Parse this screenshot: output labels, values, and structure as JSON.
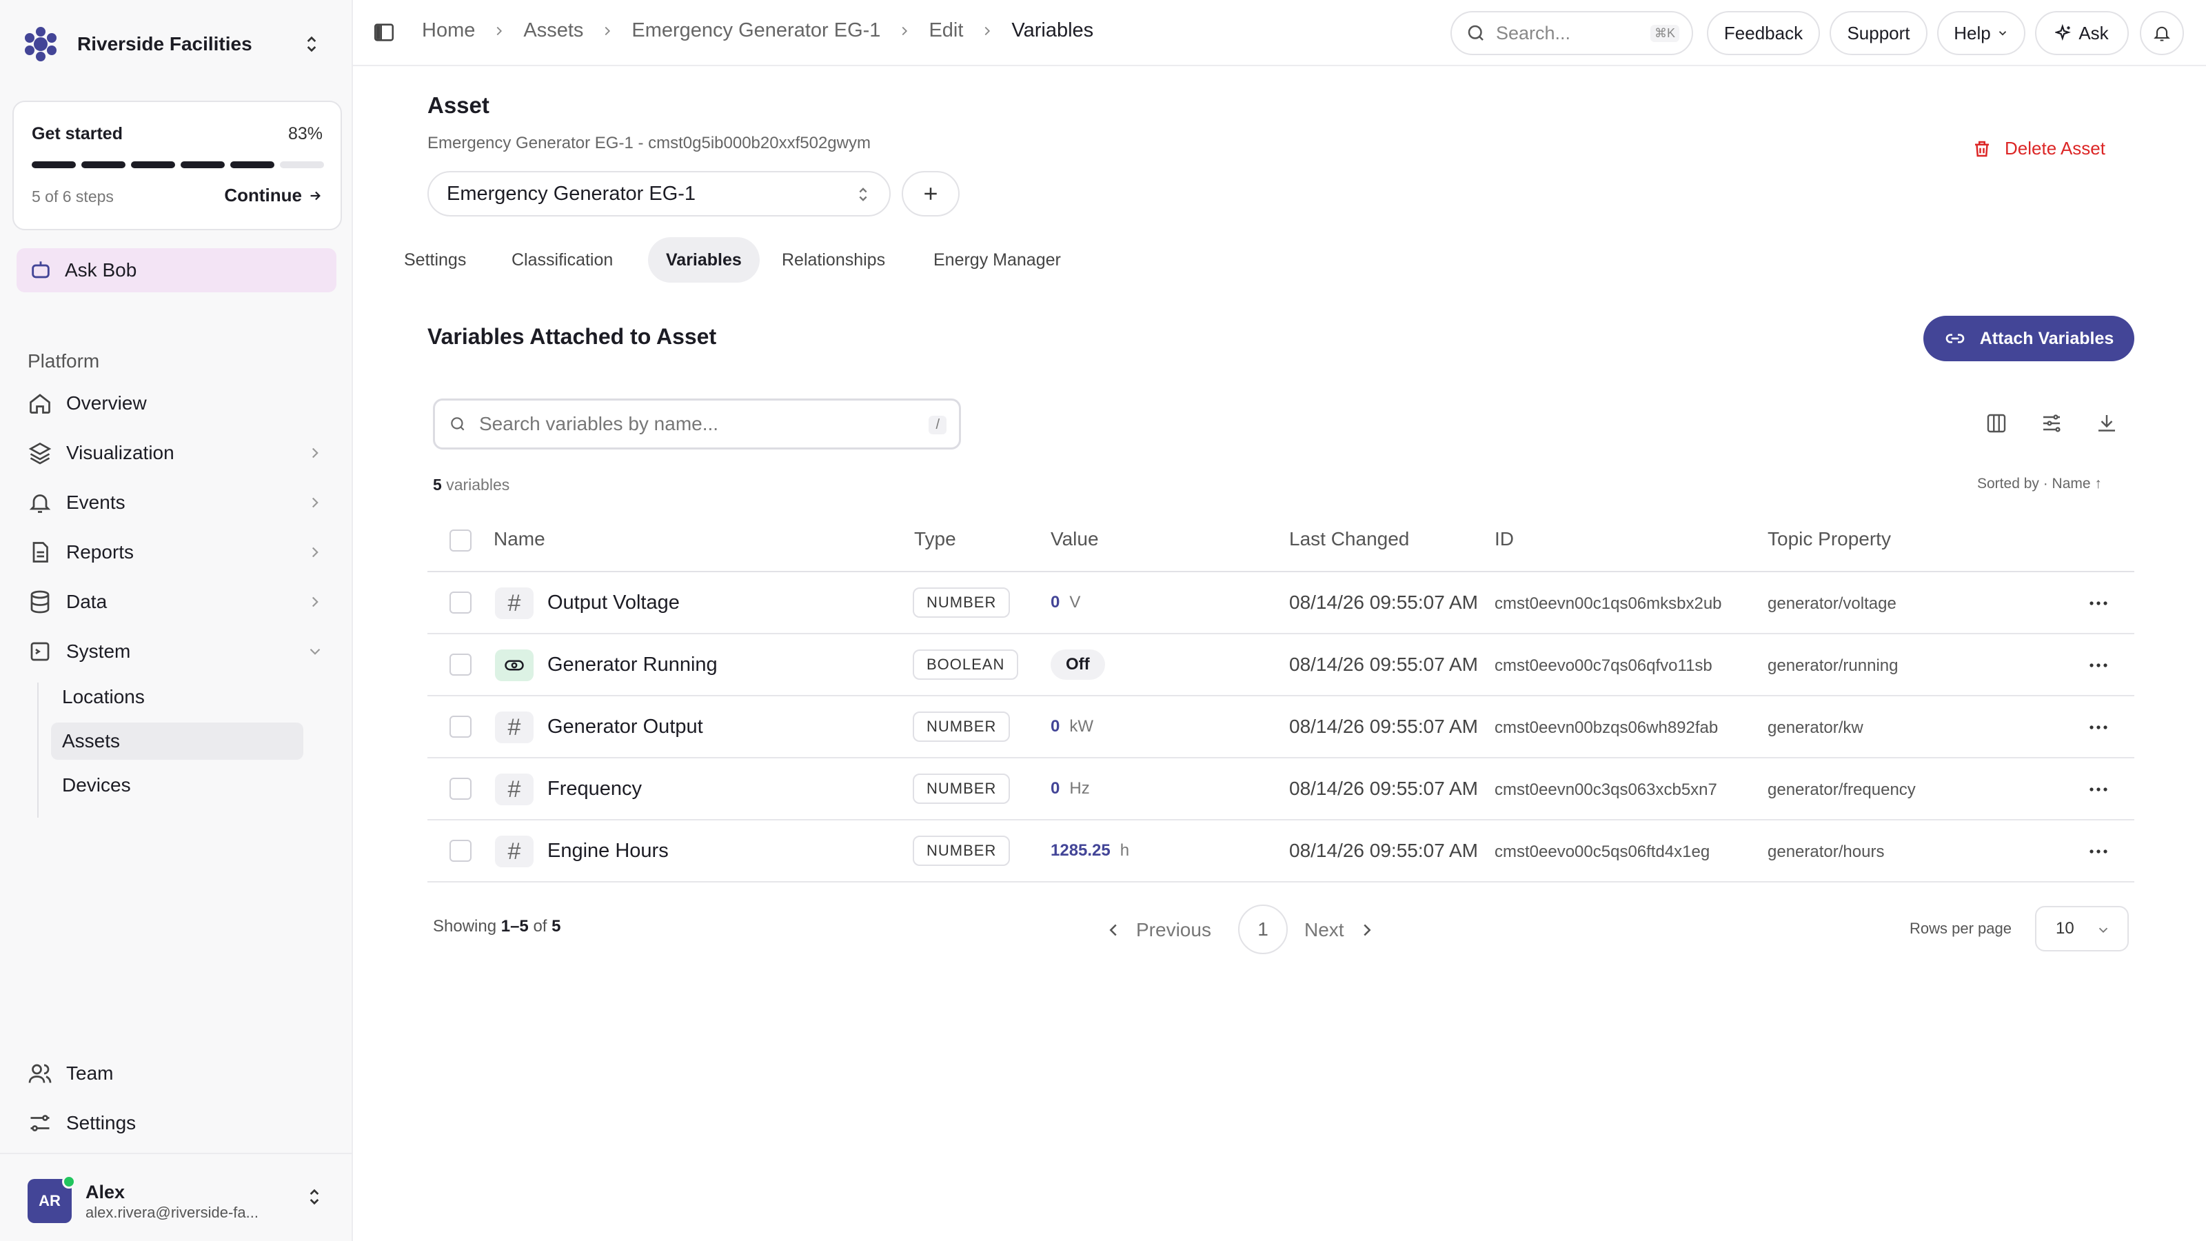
{
  "sidebar": {
    "workspace": "Riverside Facilities",
    "get_started": {
      "title": "Get started",
      "percent_label": "83%",
      "steps_label": "5 of 6 steps",
      "continue_label": "Continue",
      "progress": 0.83
    },
    "ask_bob": "Ask Bob",
    "section_title": "Platform",
    "nav": [
      {
        "label": "Overview",
        "icon": "home-icon"
      },
      {
        "label": "Visualization",
        "icon": "layers-icon"
      },
      {
        "label": "Events",
        "icon": "bell-icon"
      },
      {
        "label": "Reports",
        "icon": "report-icon"
      },
      {
        "label": "Data",
        "icon": "database-icon"
      },
      {
        "label": "System",
        "icon": "system-icon"
      }
    ],
    "system_sub": [
      "Locations",
      "Assets",
      "Devices"
    ],
    "bottom": [
      {
        "label": "Team",
        "icon": "team-icon"
      },
      {
        "label": "Settings",
        "icon": "settings-icon"
      }
    ],
    "user": {
      "initials": "AR",
      "name": "Alex",
      "email": "alex.rivera@riverside-fa..."
    }
  },
  "topbar": {
    "breadcrumbs": [
      "Home",
      "Assets",
      "Emergency Generator EG-1",
      "Edit",
      "Variables"
    ],
    "search_placeholder": "Search...",
    "search_kbd": "⌘K",
    "feedback": "Feedback",
    "support": "Support",
    "help": "Help",
    "ask": "Ask"
  },
  "asset": {
    "heading": "Asset",
    "subtitle": "Emergency Generator EG-1 - cmst0g5ib000b20xxf502gwym",
    "delete_label": "Delete Asset",
    "selected": "Emergency Generator EG-1"
  },
  "tabs": [
    "Settings",
    "Classification",
    "Variables",
    "Relationships",
    "Energy Manager"
  ],
  "variables": {
    "heading": "Variables Attached to Asset",
    "attach_label": "Attach Variables",
    "search_placeholder": "Search variables by name...",
    "search_kbd": "/",
    "count_num": "5",
    "count_label": "variables",
    "sorted_label": "Sorted by · Name ↑",
    "columns": [
      "Name",
      "Type",
      "Value",
      "Last Changed",
      "ID",
      "Topic Property"
    ],
    "rows": [
      {
        "name": "Output Voltage",
        "type": "NUMBER",
        "value": "0",
        "unit": "V",
        "changed": "08/14/26 09:55:07 AM",
        "id": "cmst0eevn00c1qs06mksbx2ub",
        "topic": "generator/voltage"
      },
      {
        "name": "Generator Running",
        "type": "BOOLEAN",
        "value": "Off",
        "unit": "",
        "changed": "08/14/26 09:55:07 AM",
        "id": "cmst0eevo00c7qs06qfvo11sb",
        "topic": "generator/running"
      },
      {
        "name": "Generator Output",
        "type": "NUMBER",
        "value": "0",
        "unit": "kW",
        "changed": "08/14/26 09:55:07 AM",
        "id": "cmst0eevn00bzqs06wh892fab",
        "topic": "generator/kw"
      },
      {
        "name": "Frequency",
        "type": "NUMBER",
        "value": "0",
        "unit": "Hz",
        "changed": "08/14/26 09:55:07 AM",
        "id": "cmst0eevn00c3qs063xcb5xn7",
        "topic": "generator/frequency"
      },
      {
        "name": "Engine Hours",
        "type": "NUMBER",
        "value": "1285.25",
        "unit": "h",
        "changed": "08/14/26 09:55:07 AM",
        "id": "cmst0eevo00c5qs06ftd4x1eg",
        "topic": "generator/hours"
      }
    ]
  },
  "pagination": {
    "showing_prefix": "Showing",
    "showing_range": "1–5",
    "showing_of": "of",
    "showing_total": "5",
    "previous": "Previous",
    "page": "1",
    "next": "Next",
    "rows_per_page_label": "Rows per page",
    "rows_per_page": "10"
  },
  "colors": {
    "accent": "#434597",
    "danger": "#dc2626",
    "ask_bob_bg": "#f3e4f5"
  }
}
